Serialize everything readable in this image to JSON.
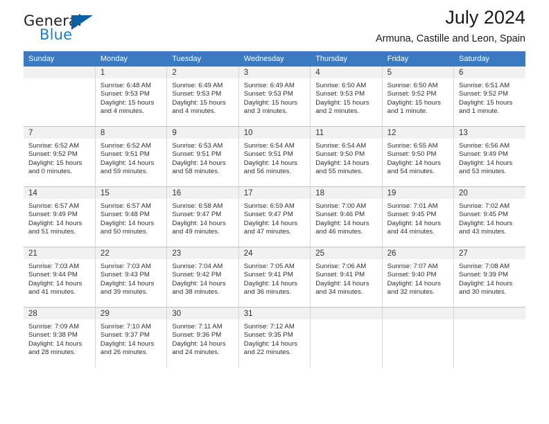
{
  "logo": {
    "word_one": "General",
    "word_two": "Blue",
    "triangle_color": "#0b5fa5",
    "blue_color": "#1b7fc4"
  },
  "header": {
    "title": "July 2024",
    "subtitle": "Armuna, Castille and Leon, Spain"
  },
  "theme": {
    "header_bg": "#3a7ac0",
    "daynum_bg": "#f1f1f1",
    "cell_bg": "#ffffff",
    "border": "#d6d6d6"
  },
  "weekdays": [
    "Sunday",
    "Monday",
    "Tuesday",
    "Wednesday",
    "Thursday",
    "Friday",
    "Saturday"
  ],
  "weeks": [
    [
      {
        "day": "",
        "empty": true,
        "sunrise": "",
        "sunset": "",
        "daylight": ""
      },
      {
        "day": "1",
        "sunrise": "Sunrise: 6:48 AM",
        "sunset": "Sunset: 9:53 PM",
        "daylight": "Daylight: 15 hours and 4 minutes."
      },
      {
        "day": "2",
        "sunrise": "Sunrise: 6:49 AM",
        "sunset": "Sunset: 9:53 PM",
        "daylight": "Daylight: 15 hours and 4 minutes."
      },
      {
        "day": "3",
        "sunrise": "Sunrise: 6:49 AM",
        "sunset": "Sunset: 9:53 PM",
        "daylight": "Daylight: 15 hours and 3 minutes."
      },
      {
        "day": "4",
        "sunrise": "Sunrise: 6:50 AM",
        "sunset": "Sunset: 9:53 PM",
        "daylight": "Daylight: 15 hours and 2 minutes."
      },
      {
        "day": "5",
        "sunrise": "Sunrise: 6:50 AM",
        "sunset": "Sunset: 9:52 PM",
        "daylight": "Daylight: 15 hours and 1 minute."
      },
      {
        "day": "6",
        "sunrise": "Sunrise: 6:51 AM",
        "sunset": "Sunset: 9:52 PM",
        "daylight": "Daylight: 15 hours and 1 minute."
      }
    ],
    [
      {
        "day": "7",
        "sunrise": "Sunrise: 6:52 AM",
        "sunset": "Sunset: 9:52 PM",
        "daylight": "Daylight: 15 hours and 0 minutes."
      },
      {
        "day": "8",
        "sunrise": "Sunrise: 6:52 AM",
        "sunset": "Sunset: 9:51 PM",
        "daylight": "Daylight: 14 hours and 59 minutes."
      },
      {
        "day": "9",
        "sunrise": "Sunrise: 6:53 AM",
        "sunset": "Sunset: 9:51 PM",
        "daylight": "Daylight: 14 hours and 58 minutes."
      },
      {
        "day": "10",
        "sunrise": "Sunrise: 6:54 AM",
        "sunset": "Sunset: 9:51 PM",
        "daylight": "Daylight: 14 hours and 56 minutes."
      },
      {
        "day": "11",
        "sunrise": "Sunrise: 6:54 AM",
        "sunset": "Sunset: 9:50 PM",
        "daylight": "Daylight: 14 hours and 55 minutes."
      },
      {
        "day": "12",
        "sunrise": "Sunrise: 6:55 AM",
        "sunset": "Sunset: 9:50 PM",
        "daylight": "Daylight: 14 hours and 54 minutes."
      },
      {
        "day": "13",
        "sunrise": "Sunrise: 6:56 AM",
        "sunset": "Sunset: 9:49 PM",
        "daylight": "Daylight: 14 hours and 53 minutes."
      }
    ],
    [
      {
        "day": "14",
        "sunrise": "Sunrise: 6:57 AM",
        "sunset": "Sunset: 9:49 PM",
        "daylight": "Daylight: 14 hours and 51 minutes."
      },
      {
        "day": "15",
        "sunrise": "Sunrise: 6:57 AM",
        "sunset": "Sunset: 9:48 PM",
        "daylight": "Daylight: 14 hours and 50 minutes."
      },
      {
        "day": "16",
        "sunrise": "Sunrise: 6:58 AM",
        "sunset": "Sunset: 9:47 PM",
        "daylight": "Daylight: 14 hours and 49 minutes."
      },
      {
        "day": "17",
        "sunrise": "Sunrise: 6:59 AM",
        "sunset": "Sunset: 9:47 PM",
        "daylight": "Daylight: 14 hours and 47 minutes."
      },
      {
        "day": "18",
        "sunrise": "Sunrise: 7:00 AM",
        "sunset": "Sunset: 9:46 PM",
        "daylight": "Daylight: 14 hours and 46 minutes."
      },
      {
        "day": "19",
        "sunrise": "Sunrise: 7:01 AM",
        "sunset": "Sunset: 9:45 PM",
        "daylight": "Daylight: 14 hours and 44 minutes."
      },
      {
        "day": "20",
        "sunrise": "Sunrise: 7:02 AM",
        "sunset": "Sunset: 9:45 PM",
        "daylight": "Daylight: 14 hours and 43 minutes."
      }
    ],
    [
      {
        "day": "21",
        "sunrise": "Sunrise: 7:03 AM",
        "sunset": "Sunset: 9:44 PM",
        "daylight": "Daylight: 14 hours and 41 minutes."
      },
      {
        "day": "22",
        "sunrise": "Sunrise: 7:03 AM",
        "sunset": "Sunset: 9:43 PM",
        "daylight": "Daylight: 14 hours and 39 minutes."
      },
      {
        "day": "23",
        "sunrise": "Sunrise: 7:04 AM",
        "sunset": "Sunset: 9:42 PM",
        "daylight": "Daylight: 14 hours and 38 minutes."
      },
      {
        "day": "24",
        "sunrise": "Sunrise: 7:05 AM",
        "sunset": "Sunset: 9:41 PM",
        "daylight": "Daylight: 14 hours and 36 minutes."
      },
      {
        "day": "25",
        "sunrise": "Sunrise: 7:06 AM",
        "sunset": "Sunset: 9:41 PM",
        "daylight": "Daylight: 14 hours and 34 minutes."
      },
      {
        "day": "26",
        "sunrise": "Sunrise: 7:07 AM",
        "sunset": "Sunset: 9:40 PM",
        "daylight": "Daylight: 14 hours and 32 minutes."
      },
      {
        "day": "27",
        "sunrise": "Sunrise: 7:08 AM",
        "sunset": "Sunset: 9:39 PM",
        "daylight": "Daylight: 14 hours and 30 minutes."
      }
    ],
    [
      {
        "day": "28",
        "sunrise": "Sunrise: 7:09 AM",
        "sunset": "Sunset: 9:38 PM",
        "daylight": "Daylight: 14 hours and 28 minutes."
      },
      {
        "day": "29",
        "sunrise": "Sunrise: 7:10 AM",
        "sunset": "Sunset: 9:37 PM",
        "daylight": "Daylight: 14 hours and 26 minutes."
      },
      {
        "day": "30",
        "sunrise": "Sunrise: 7:11 AM",
        "sunset": "Sunset: 9:36 PM",
        "daylight": "Daylight: 14 hours and 24 minutes."
      },
      {
        "day": "31",
        "sunrise": "Sunrise: 7:12 AM",
        "sunset": "Sunset: 9:35 PM",
        "daylight": "Daylight: 14 hours and 22 minutes."
      },
      {
        "day": "",
        "empty": true,
        "sunrise": "",
        "sunset": "",
        "daylight": ""
      },
      {
        "day": "",
        "empty": true,
        "sunrise": "",
        "sunset": "",
        "daylight": ""
      },
      {
        "day": "",
        "empty": true,
        "sunrise": "",
        "sunset": "",
        "daylight": ""
      }
    ]
  ]
}
